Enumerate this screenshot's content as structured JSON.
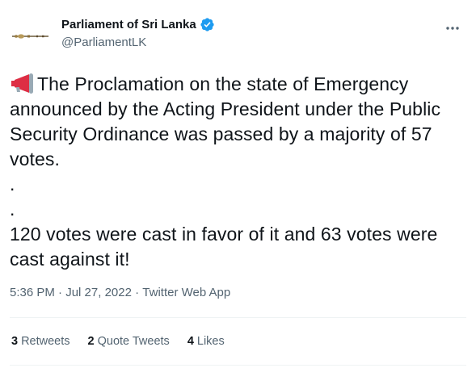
{
  "author": {
    "display_name": "Parliament of Sri Lanka",
    "handle": "@ParliamentLK",
    "verified": true,
    "avatar_icon": "mace-icon"
  },
  "tweet": {
    "emoji_icon": "megaphone-icon",
    "text": "The Proclamation on the state of Emergency announced by the Acting President under the Public Security Ordinance was passed by a majority of 57 votes.\n.\n.\n120 votes were cast in favor of it and 63 votes were cast against it!"
  },
  "meta": {
    "time": "5:36 PM",
    "separator": " · ",
    "date": "Jul 27, 2022",
    "source": "Twitter Web App"
  },
  "stats": {
    "retweets_count": "3",
    "retweets_label": "Retweets",
    "quote_tweets_count": "2",
    "quote_tweets_label": "Quote Tweets",
    "likes_count": "4",
    "likes_label": "Likes"
  },
  "colors": {
    "text": "#0f1419",
    "secondary": "#536471",
    "verified": "#1d9bf0",
    "megaphone": "#dd2e44",
    "divider": "#eff3f4"
  }
}
